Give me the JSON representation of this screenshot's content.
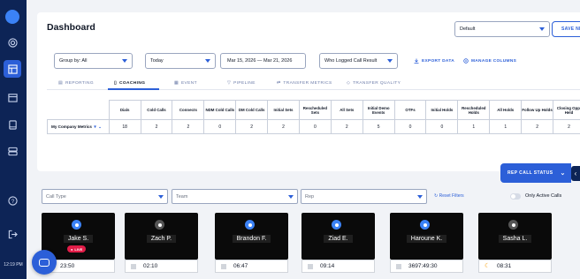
{
  "sidebar": {
    "time": "12:19 PM",
    "icons": [
      "user-avatar-icon",
      "radar-icon",
      "dashboard-icon",
      "calendar-icon",
      "tablet-icon",
      "server-icon",
      "help-icon",
      "logout-icon"
    ]
  },
  "dashboard": {
    "title": "Dashboard",
    "view_select": "Default",
    "save_label": "SAVE NE",
    "group_by": "Group by: All",
    "period": "Today",
    "date_range": "Mar 15, 2026 — Mar 21, 2026",
    "logged_by": "Who Logged Call Result",
    "export_label": "EXPORT DATA",
    "manage_label": "MANAGE COLUMNS",
    "tabs": [
      {
        "label": "REPORTING",
        "icon": "document-icon"
      },
      {
        "label": "COACHING",
        "icon": "clipboard-icon"
      },
      {
        "label": "EVENT",
        "icon": "calendar-icon"
      },
      {
        "label": "PIPELINE",
        "icon": "funnel-icon"
      },
      {
        "label": "TRANSFER METRICS",
        "icon": "transfer-icon"
      },
      {
        "label": "TRANSFER QUALITY",
        "icon": "shield-icon"
      }
    ],
    "table": {
      "headers": [
        "Dials",
        "Cold Calls",
        "Connects",
        "NDM Cold Calls",
        "DM Cold Calls",
        "Initial Sets",
        "Rescheduled Sets",
        "All Sets",
        "Initial Demo Events",
        "OTFs",
        "Initial Holds",
        "Rescheduled Holds",
        "All Holds",
        "Follow Up Holds",
        "Closing Opp. Held"
      ],
      "row_label": "My Company Metrics",
      "row": [
        "18",
        "2",
        "2",
        "0",
        "2",
        "2",
        "0",
        "2",
        "5",
        "0",
        "0",
        "1",
        "1",
        "2",
        "2"
      ]
    }
  },
  "filters": {
    "call_type": "Call Type",
    "team": "Team",
    "rep": "Rep",
    "reset": "Reset Filters",
    "only_active": "Only Active Calls"
  },
  "rep_status": {
    "label": "REP CALL STATUS"
  },
  "reps": [
    {
      "name": "Jake S.",
      "time": "23:50",
      "live": "LIVE",
      "status_icon": "live"
    },
    {
      "name": "Zach P.",
      "time": "02:10",
      "status_icon": "idle"
    },
    {
      "name": "Brandon F.",
      "time": "06:47",
      "status_icon": "idle"
    },
    {
      "name": "Ziad E.",
      "time": "09:14",
      "status_icon": "idle"
    },
    {
      "name": "Haroune K.",
      "time": "3697:49:30",
      "status_icon": "idle"
    },
    {
      "name": "Sasha L.",
      "time": "08:31",
      "status_icon": "away"
    }
  ]
}
